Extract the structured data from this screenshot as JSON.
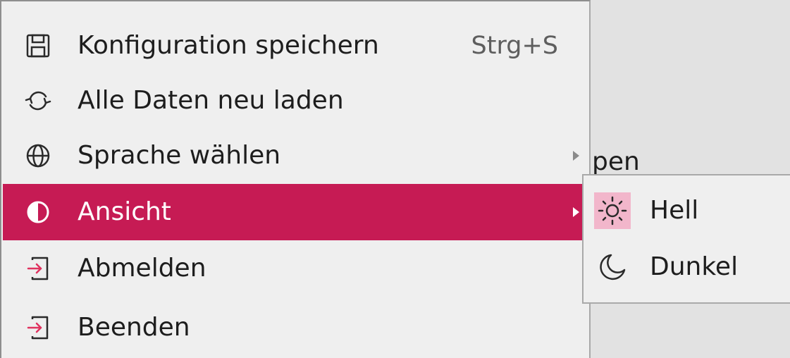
{
  "background": {
    "partial_text": "pen"
  },
  "menu": {
    "items": [
      {
        "label": "Konfiguration speichern",
        "shortcut": "Strg+S",
        "icon": "save-icon"
      },
      {
        "label": "Alle Daten neu laden",
        "icon": "reload-icon"
      },
      {
        "label": "Sprache wählen",
        "icon": "globe-icon",
        "has_submenu": true
      },
      {
        "label": "Ansicht",
        "icon": "contrast-icon",
        "has_submenu": true,
        "active": true
      },
      {
        "label": "Abmelden",
        "icon": "logout-icon"
      },
      {
        "label": "Beenden",
        "icon": "exit-icon"
      }
    ]
  },
  "submenu": {
    "items": [
      {
        "label": "Hell",
        "icon": "sun-icon",
        "selected": true
      },
      {
        "label": "Dunkel",
        "icon": "moon-icon"
      }
    ]
  },
  "colors": {
    "accent": "#c61b54",
    "icon_red": "#e0325f",
    "selected_bg": "#f2b6cb"
  }
}
